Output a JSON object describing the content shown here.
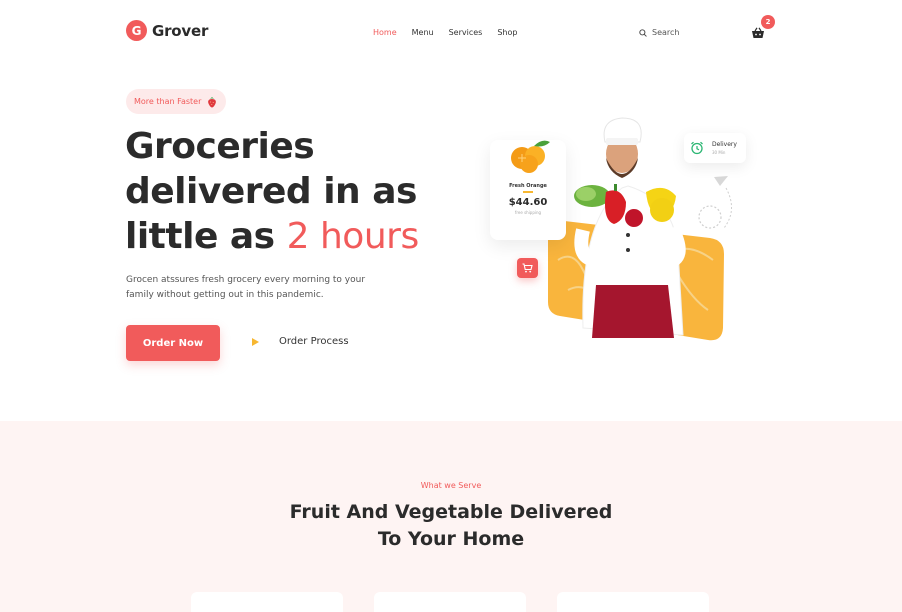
{
  "header": {
    "logo_mark": "G",
    "logo_text": "Grover",
    "nav": [
      {
        "label": "Home",
        "active": true
      },
      {
        "label": "Menu",
        "active": false
      },
      {
        "label": "Services",
        "active": false
      },
      {
        "label": "Shop",
        "active": false
      }
    ],
    "search_label": "Search",
    "cart_count": "2"
  },
  "hero": {
    "tagline": "More than Faster",
    "title_line1": "Groceries",
    "title_line2": "delivered in as",
    "title_line3_prefix": "little as ",
    "title_highlight": "2 hours",
    "description": "Grocen atssures fresh grocery every morning to your family without getting out in this pandemic.",
    "order_button": "Order Now",
    "process_link": "Order Process"
  },
  "product_card": {
    "name": "Fresh Orange",
    "price": "$44.60",
    "subtext": "free shipping"
  },
  "delivery_card": {
    "title": "Delivery",
    "time": "30 Min"
  },
  "section2": {
    "eyebrow": "What we Serve",
    "title_line1": "Fruit And Vegetable Delivered",
    "title_line2": "To Your Home"
  },
  "colors": {
    "accent": "#f15b5b",
    "yellow": "#f7b731",
    "section_bg": "#fef4f3",
    "text_dark": "#2b2b2b"
  }
}
